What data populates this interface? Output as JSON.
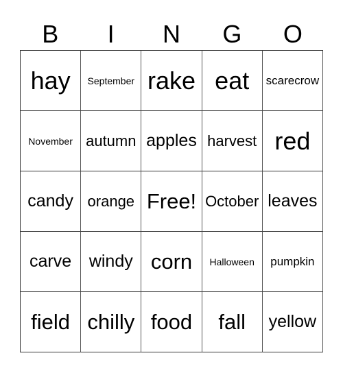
{
  "header": {
    "letters": [
      "B",
      "I",
      "N",
      "G",
      "O"
    ]
  },
  "board": {
    "rows": [
      [
        "hay",
        "September",
        "rake",
        "eat",
        "scarecrow"
      ],
      [
        "November",
        "autumn",
        "apples",
        "harvest",
        "red"
      ],
      [
        "candy",
        "orange",
        "Free!",
        "October",
        "leaves"
      ],
      [
        "carve",
        "windy",
        "corn",
        "Halloween",
        "pumpkin"
      ],
      [
        "field",
        "chilly",
        "food",
        "fall",
        "yellow"
      ]
    ],
    "free_space": "Free!"
  }
}
